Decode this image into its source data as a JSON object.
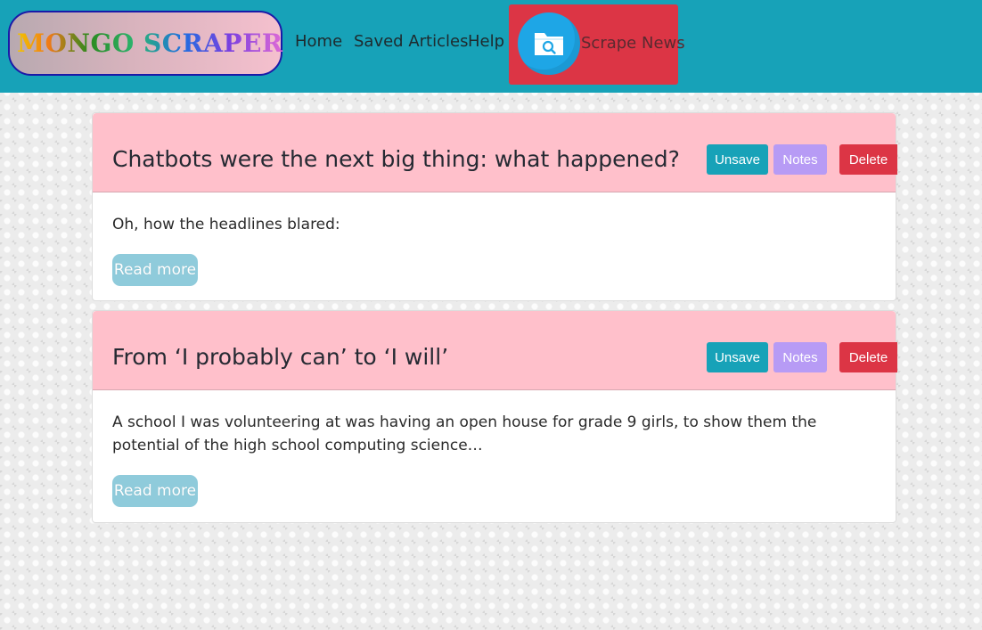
{
  "navbar": {
    "brand": "MONGO SCRAPER",
    "links": {
      "home": "Home",
      "saved": "Saved Articles",
      "help": "Help"
    },
    "scrape_button": {
      "label": "Scrape News",
      "icon": "folder-search-icon"
    }
  },
  "articles": [
    {
      "title": "Chatbots were the next big thing: what happened?",
      "summary": "Oh, how the headlines blared:",
      "buttons": {
        "unsave": "Unsave",
        "notes": "Notes",
        "delete": "Delete"
      },
      "read_more": "Read more"
    },
    {
      "title": "From ‘I probably can’ to ‘I will’",
      "summary": "A school I was volunteering at was having an open house for grade 9 girls, to show them the potential of the high school computing science…",
      "buttons": {
        "unsave": "Unsave",
        "notes": "Notes",
        "delete": "Delete"
      },
      "read_more": "Read more"
    }
  ],
  "colors": {
    "navbar_bg": "#17a2b8",
    "scrape_bg": "#dc3545",
    "card_header_bg": "#ffc0cb",
    "unsave_bg": "#17a2b8",
    "notes_bg": "#b79bf5",
    "delete_bg": "#dc3545",
    "read_more_bg": "#8fcbdb"
  }
}
